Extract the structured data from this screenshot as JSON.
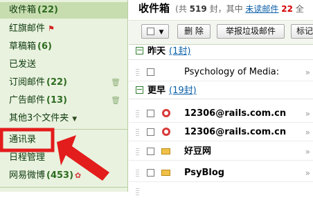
{
  "sidebar": {
    "items": [
      {
        "label": "收件箱",
        "count": "(22)"
      },
      {
        "label": "红旗邮件",
        "count": ""
      },
      {
        "label": "草稿箱",
        "count": "(6)"
      },
      {
        "label": "已发送",
        "count": ""
      },
      {
        "label": "订阅邮件",
        "count": "(22)"
      },
      {
        "label": "广告邮件",
        "count": "(13)"
      },
      {
        "label": "其他3个文件夹",
        "count": ""
      },
      {
        "label": "通讯录",
        "count": ""
      },
      {
        "label": "日程管理",
        "count": ""
      },
      {
        "label": "网易微博",
        "count": "(453)"
      }
    ]
  },
  "header": {
    "title": "收件箱",
    "meta_prefix": "(共",
    "total": "519",
    "meta_mid": "封，其中",
    "unread_link": "未读邮件",
    "unread_count": "22",
    "meta_suffix": "全"
  },
  "toolbar": {
    "delete_label": "删 除",
    "spam_label": "举报垃圾邮件",
    "mark_label": "标记"
  },
  "groups": [
    {
      "name": "昨天",
      "count": "(1封)"
    },
    {
      "name": "更早",
      "count": "(19封)"
    }
  ],
  "messages": [
    {
      "from": "Psychology of Media:",
      "read": true,
      "icon": "none"
    },
    {
      "from": "12306@rails.com.cn",
      "read": false,
      "icon": "read-receipt-icon"
    },
    {
      "from": "12306@rails.com.cn",
      "read": false,
      "icon": "read-receipt-icon"
    },
    {
      "from": "好豆网",
      "read": false,
      "icon": "envelope-icon"
    },
    {
      "from": "PsyBlog",
      "read": false,
      "icon": "envelope-icon"
    }
  ],
  "colors": {
    "accent_green": "#2d6b1f",
    "annotation_red": "#e31c1c",
    "link_blue": "#0a5fa8"
  }
}
